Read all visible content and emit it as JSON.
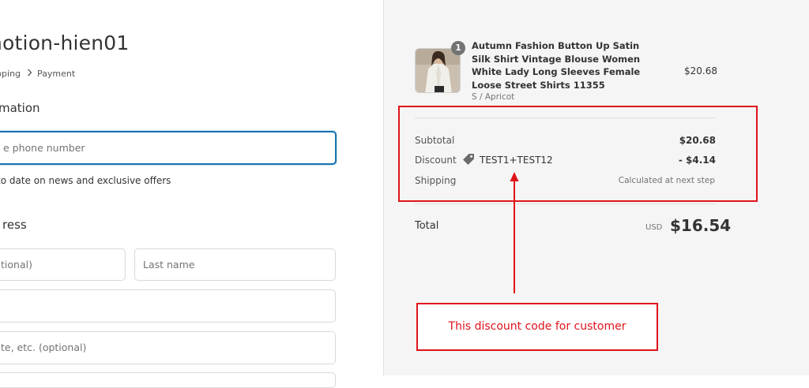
{
  "store": {
    "name": "notion-hien01"
  },
  "breadcrumb": {
    "prev": "ipping",
    "current": "Payment"
  },
  "contact": {
    "heading": "mation",
    "phone_placeholder": "e phone number",
    "optin_label": "to date on news and exclusive offers"
  },
  "address": {
    "heading": "ress",
    "first_name_placeholder": "tional)",
    "last_name_placeholder": "Last name",
    "address_placeholder": "",
    "apartment_placeholder": "te, etc. (optional)"
  },
  "order": {
    "item": {
      "quantity": "1",
      "name": "Autumn Fashion Button Up Satin Silk Shirt Vintage Blouse Women White Lady Long Sleeves Female Loose Street Shirts 11355",
      "variant": "S / Apricot",
      "price": "$20.68"
    },
    "subtotal_label": "Subtotal",
    "subtotal_value": "$20.68",
    "discount_label": "Discount",
    "discount_code": "TEST1+TEST12",
    "discount_value": "- $4.14",
    "shipping_label": "Shipping",
    "shipping_value": "Calculated at next step",
    "total_label": "Total",
    "currency": "USD",
    "total_value": "$16.54"
  },
  "annotation": {
    "note": "This discount code for customer"
  },
  "colors": {
    "annotation_red": "#e0131b",
    "focus_blue": "#1773b0",
    "sidebar_bg": "#f5f5f5"
  },
  "icons": {
    "breadcrumb_separator": "chevron-right-icon",
    "discount": "tag-icon"
  }
}
